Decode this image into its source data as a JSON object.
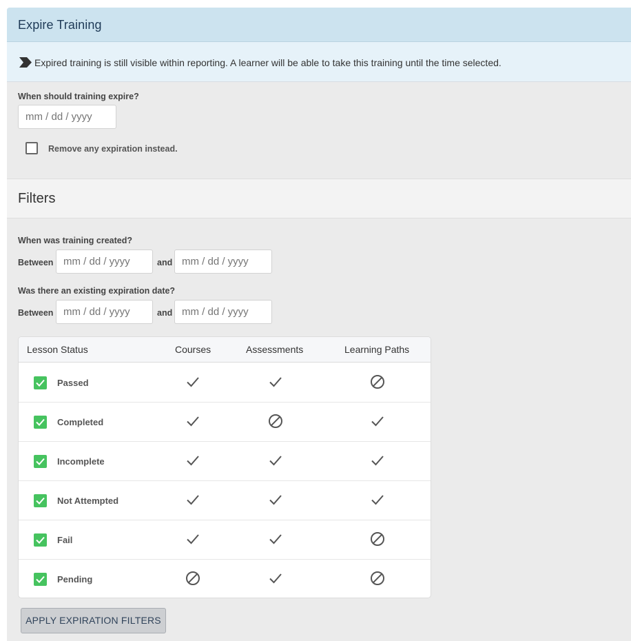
{
  "panel": {
    "title": "Expire Training",
    "info_text": "Expired training is still visible within reporting. A learner will be able to take this training until the time selected."
  },
  "expire": {
    "question": "When should training expire?",
    "date_placeholder": "mm / dd / yyyy",
    "remove_label": "Remove any expiration instead.",
    "remove_checked": false
  },
  "filters": {
    "title": "Filters",
    "created": {
      "question": "When was training created?",
      "between_label": "Between",
      "and_label": "and",
      "from_placeholder": "mm / dd / yyyy",
      "to_placeholder": "mm / dd / yyyy"
    },
    "existing": {
      "question": "Was there an existing expiration date?",
      "between_label": "Between",
      "and_label": "and",
      "from_placeholder": "mm / dd / yyyy",
      "to_placeholder": "mm / dd / yyyy"
    }
  },
  "status_table": {
    "headers": [
      "Lesson Status",
      "Courses",
      "Assessments",
      "Learning Paths"
    ],
    "rows": [
      {
        "label": "Passed",
        "checked": true,
        "courses": "check",
        "assessments": "check",
        "learning_paths": "not-allowed"
      },
      {
        "label": "Completed",
        "checked": true,
        "courses": "check",
        "assessments": "not-allowed",
        "learning_paths": "check"
      },
      {
        "label": "Incomplete",
        "checked": true,
        "courses": "check",
        "assessments": "check",
        "learning_paths": "check"
      },
      {
        "label": "Not Attempted",
        "checked": true,
        "courses": "check",
        "assessments": "check",
        "learning_paths": "check"
      },
      {
        "label": "Fail",
        "checked": true,
        "courses": "check",
        "assessments": "check",
        "learning_paths": "not-allowed"
      },
      {
        "label": "Pending",
        "checked": true,
        "courses": "not-allowed",
        "assessments": "check",
        "learning_paths": "not-allowed"
      }
    ]
  },
  "actions": {
    "apply_label": "APPLY EXPIRATION FILTERS"
  },
  "colors": {
    "header_bg": "#cce3ef",
    "info_bg": "#e6f2f9",
    "panel_bg": "#ebebeb",
    "check_green": "#46c35f",
    "title_color": "#1e3a57"
  }
}
